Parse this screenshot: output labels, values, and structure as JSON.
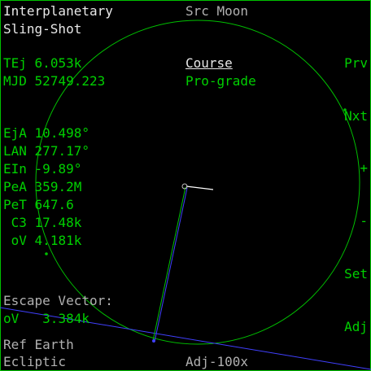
{
  "title_line1": "Interplanetary",
  "title_line2": "Sling-Shot",
  "source": "Src Moon",
  "tej": {
    "label": "TEj",
    "value": "6.053k"
  },
  "mjd": {
    "label": "MJD",
    "value": "52749.223"
  },
  "course": {
    "heading": "Course",
    "value": "Pro-grade"
  },
  "params": [
    {
      "label": "EjA",
      "value": "10.498°"
    },
    {
      "label": "LAN",
      "value": "277.17°"
    },
    {
      "label": "EIn",
      "value": "-9.89°"
    },
    {
      "label": "PeA",
      "value": "359.2M"
    },
    {
      "label": "PeT",
      "value": "647.6"
    },
    {
      "label": " C3",
      "value": "17.48k"
    },
    {
      "label": " oV",
      "value": "4.181k"
    }
  ],
  "escape": {
    "heading": "Escape Vector:",
    "label": "oV",
    "value": "3.384k"
  },
  "ref": {
    "label": "Ref",
    "value": "Earth"
  },
  "frame": "Ecliptic",
  "adjust_step": "Adj-100x",
  "softkeys": [
    "Prv",
    "Nxt",
    "+",
    "-",
    "Set",
    "Adj"
  ],
  "colors": {
    "border": "#00c000",
    "orbit": "#00c000",
    "escape_line": "#4040ff",
    "text_green": "#00d000",
    "text_white": "#e8e8e8"
  }
}
